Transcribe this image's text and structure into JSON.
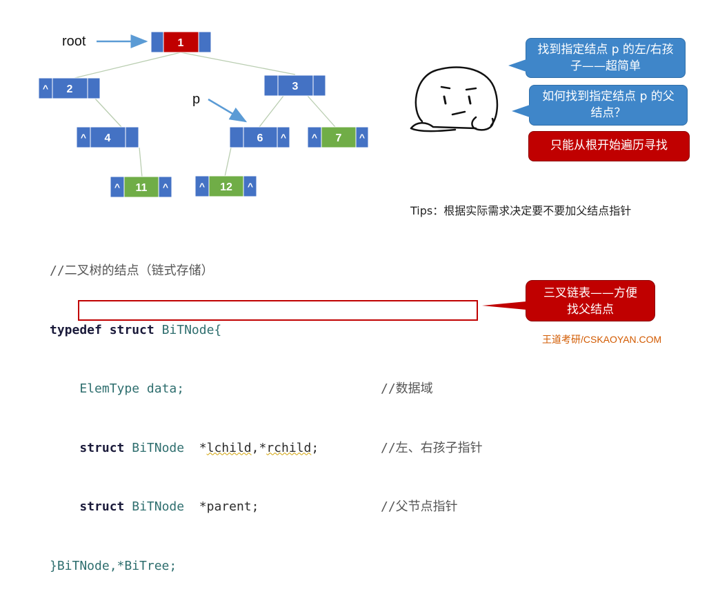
{
  "diagram": {
    "root_label": "root",
    "p_label": "p",
    "null_symbol": "^",
    "nodes": [
      {
        "id": "1",
        "label": "1",
        "color": "#c00000"
      },
      {
        "id": "2",
        "label": "2",
        "color": "#4472c4"
      },
      {
        "id": "3",
        "label": "3",
        "color": "#4472c4"
      },
      {
        "id": "4",
        "label": "4",
        "color": "#4472c4"
      },
      {
        "id": "6",
        "label": "6",
        "color": "#4472c4"
      },
      {
        "id": "7",
        "label": "7",
        "color": "#70ad47"
      },
      {
        "id": "11",
        "label": "11",
        "color": "#70ad47"
      },
      {
        "id": "12",
        "label": "12",
        "color": "#70ad47"
      }
    ],
    "edges": [
      [
        "1",
        "2"
      ],
      [
        "1",
        "3"
      ],
      [
        "2",
        "4"
      ],
      [
        "3",
        "6"
      ],
      [
        "3",
        "7"
      ],
      [
        "4",
        "11"
      ],
      [
        "6",
        "12"
      ]
    ]
  },
  "bubbles": {
    "b1": "找到指定结点 p 的左/右孩子——超简单",
    "b2": "如何找到指定结点 p 的父结点？",
    "b3": "只能从根开始遍历寻找"
  },
  "tips": "Tips：根据实际需求决定要不要加父结点指针",
  "code": {
    "comment_title": "//二叉树的结点（链式存储）",
    "kw_typedef": "typedef",
    "kw_struct": "struct",
    "struct_name": "BiTNode{",
    "line2_type": "ElemType",
    "line2_rest": " data;",
    "line2_comment": "//数据域",
    "line3_type": "BiTNode",
    "line3_rest": "  *",
    "line3_lchild": "lchild",
    "line3_mid": ",*",
    "line3_rchild": "rchild",
    "line3_end": ";",
    "line3_comment": "//左、右孩子指针",
    "line4_type": "BiTNode",
    "line4_rest": "  *parent;",
    "line4_comment": "//父节点指针",
    "closing": "}BiTNode,*BiTree;"
  },
  "callout": {
    "line1": "三叉链表——方便",
    "line2": "找父结点"
  },
  "footer": "王道考研/CSKAOYAN.COM"
}
